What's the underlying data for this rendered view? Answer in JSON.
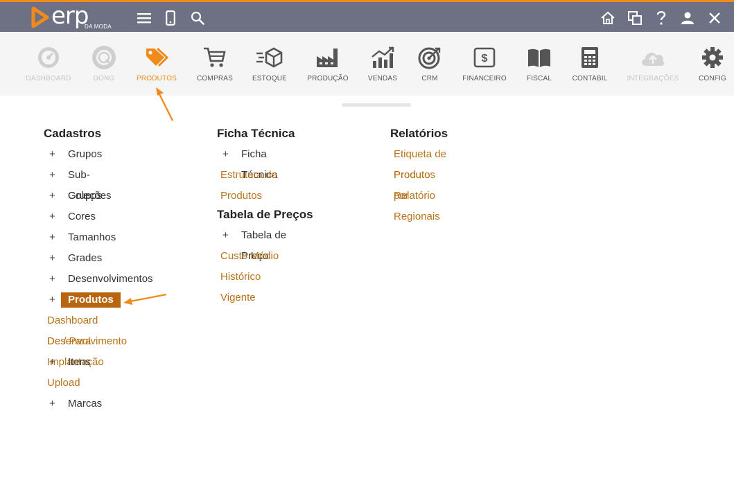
{
  "brand": {
    "name": "erp",
    "sub": "DA MODA",
    "accent": "#f08a1c"
  },
  "topbar_icons": [
    "menu-icon",
    "mobile-icon",
    "search-icon",
    "home-icon",
    "windows-icon",
    "help-icon",
    "user-icon",
    "close-icon"
  ],
  "modules": [
    {
      "label": "DASHBOARD",
      "icon": "dashboard-icon",
      "state": "dim"
    },
    {
      "label": "DONG",
      "icon": "dong-icon",
      "state": "dim"
    },
    {
      "label": "PRODUTOS",
      "icon": "tags-icon",
      "state": "active"
    },
    {
      "label": "COMPRAS",
      "icon": "cart-icon",
      "state": "normal"
    },
    {
      "label": "ESTOQUE",
      "icon": "box-icon",
      "state": "normal"
    },
    {
      "label": "PRODUÇÃO",
      "icon": "factory-icon",
      "state": "normal"
    },
    {
      "label": "VENDAS",
      "icon": "chart-icon",
      "state": "normal"
    },
    {
      "label": "CRM",
      "icon": "target-icon",
      "state": "normal"
    },
    {
      "label": "FINANCEIRO",
      "icon": "money-icon",
      "state": "normal"
    },
    {
      "label": "FISCAL",
      "icon": "book-icon",
      "state": "normal"
    },
    {
      "label": "CONTABIL",
      "icon": "calculator-icon",
      "state": "normal"
    },
    {
      "label": "INTEGRAÇÕES",
      "icon": "cloud-upload-icon",
      "state": "dim"
    },
    {
      "label": "CONFIG",
      "icon": "gear-icon",
      "state": "normal"
    }
  ],
  "cadastros": {
    "title": "Cadastros",
    "items": [
      {
        "label": "Grupos",
        "type": "plus"
      },
      {
        "label": "Sub-Grupos",
        "type": "plus"
      },
      {
        "label": "Coleções",
        "type": "plus"
      },
      {
        "label": "Cores",
        "type": "plus"
      },
      {
        "label": "Tamanhos",
        "type": "plus"
      },
      {
        "label": "Grades",
        "type": "plus"
      },
      {
        "label": "Desenvolvimentos",
        "type": "plus"
      },
      {
        "label": "Produtos",
        "type": "selected"
      },
      {
        "label": "Dashboard Desenvolvimento",
        "type": "link"
      },
      {
        "label": "De / Para Implantação",
        "type": "link"
      },
      {
        "label": "Itens",
        "type": "plus"
      },
      {
        "label": "Upload",
        "type": "link"
      },
      {
        "label": "Marcas",
        "type": "plus"
      }
    ]
  },
  "ficha": {
    "title": "Ficha Técnica",
    "items": [
      {
        "label": "Ficha Técnica",
        "type": "plus"
      },
      {
        "label": "Estrutura de Produtos",
        "type": "link"
      }
    ]
  },
  "tabela": {
    "title": "Tabela de Preços",
    "items": [
      {
        "label": "Tabela de Preço",
        "type": "plus"
      },
      {
        "label": "Custo Médio",
        "type": "link"
      },
      {
        "label": "Histórico",
        "type": "link"
      },
      {
        "label": "Vigente",
        "type": "link"
      }
    ]
  },
  "relatorios": {
    "title": "Relatórios",
    "items": [
      {
        "label": "Etiqueta de Produto",
        "type": "link"
      },
      {
        "label": "Produtos por Regionais",
        "type": "link"
      },
      {
        "label": "Relatório",
        "type": "link"
      }
    ]
  },
  "plus_symbol": "+",
  "colors": {
    "topbar": "#6e7183",
    "accent": "#f08a1c",
    "link": "#b8731a",
    "selected_bg": "#b8650f",
    "ribbon": "#f5f5f5"
  }
}
